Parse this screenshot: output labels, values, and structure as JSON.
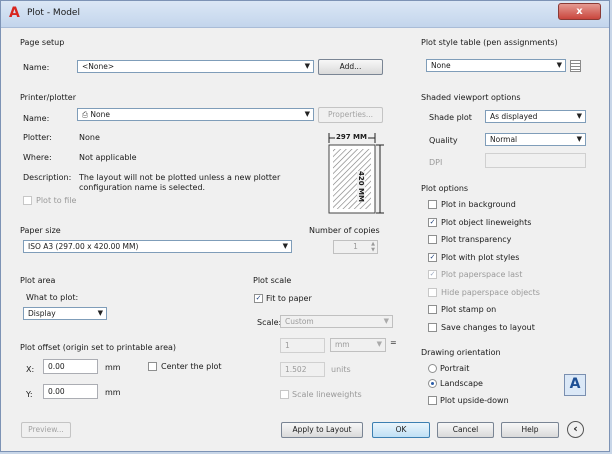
{
  "window": {
    "title": "Plot - Model",
    "close_label": "x"
  },
  "page_setup": {
    "heading": "Page setup",
    "name_label": "Name:",
    "name_value": "<None>",
    "add_button": "Add..."
  },
  "printer": {
    "heading": "Printer/plotter",
    "name_label": "Name:",
    "name_value": "None",
    "properties_button": "Properties...",
    "plotter_label": "Plotter:",
    "plotter_value": "None",
    "where_label": "Where:",
    "where_value": "Not applicable",
    "description_label": "Description:",
    "description_line1": "The layout will not be plotted unless a new plotter",
    "description_line2": "configuration name is selected.",
    "plot_to_file": "Plot to file",
    "preview_width": "297 MM",
    "preview_height": "420 MM"
  },
  "paper_size": {
    "heading": "Paper size",
    "value": "ISO A3 (297.00 x 420.00 MM)"
  },
  "copies": {
    "heading": "Number of copies",
    "value": "1"
  },
  "plot_area": {
    "heading": "Plot area",
    "what_label": "What to plot:",
    "what_value": "Display"
  },
  "plot_scale": {
    "heading": "Plot scale",
    "fit_label": "Fit to paper",
    "scale_label": "Scale:",
    "scale_value": "Custom",
    "value1": "1",
    "unit1": "mm",
    "equals": "=",
    "value2": "1.502",
    "unit2": "units",
    "lineweights_label": "Scale lineweights"
  },
  "plot_offset": {
    "heading": "Plot offset (origin set to printable area)",
    "x_label": "X:",
    "x_value": "0.00",
    "x_unit": "mm",
    "y_label": "Y:",
    "y_value": "0.00",
    "y_unit": "mm",
    "center_label": "Center the plot"
  },
  "style_table": {
    "heading": "Plot style table (pen assignments)",
    "value": "None"
  },
  "shaded": {
    "heading": "Shaded viewport options",
    "shade_label": "Shade plot",
    "shade_value": "As displayed",
    "quality_label": "Quality",
    "quality_value": "Normal",
    "dpi_label": "DPI"
  },
  "plot_options": {
    "heading": "Plot options",
    "items": [
      {
        "label": "Plot in background",
        "checked": false,
        "disabled": false
      },
      {
        "label": "Plot object lineweights",
        "checked": true,
        "disabled": false
      },
      {
        "label": "Plot transparency",
        "checked": false,
        "disabled": false
      },
      {
        "label": "Plot with plot styles",
        "checked": true,
        "disabled": false
      },
      {
        "label": "Plot paperspace last",
        "checked": true,
        "disabled": true
      },
      {
        "label": "Hide paperspace objects",
        "checked": false,
        "disabled": true
      },
      {
        "label": "Plot stamp on",
        "checked": false,
        "disabled": false
      },
      {
        "label": "Save changes to layout",
        "checked": false,
        "disabled": false
      }
    ]
  },
  "orientation": {
    "heading": "Drawing orientation",
    "portrait": "Portrait",
    "landscape": "Landscape",
    "upside_down": "Plot upside-down",
    "selected": "Landscape"
  },
  "footer": {
    "preview": "Preview...",
    "apply": "Apply to Layout",
    "ok": "OK",
    "cancel": "Cancel",
    "help": "Help"
  },
  "colors": {
    "accent": "#2a5ca8",
    "title_icon": "#d8261f",
    "close": "#c9463d"
  }
}
